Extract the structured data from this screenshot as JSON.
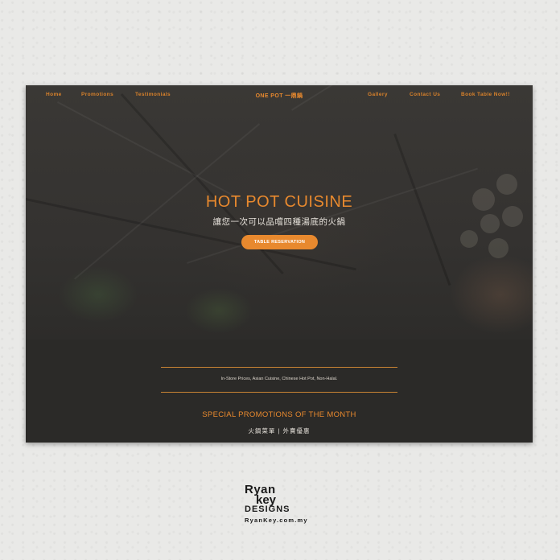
{
  "nav": {
    "left_items": [
      "Home",
      "Promotions",
      "Testimonials"
    ],
    "brand": "ONE POT 一鼎鍋",
    "right_items": [
      "Gallery",
      "Contact Us",
      "Book Table Now!!"
    ]
  },
  "hero": {
    "title": "HOT POT CUISINE",
    "subtitle": "讓您一次可以品嚐四種湯底的火鍋",
    "cta_label": "TABLE RESERVATION"
  },
  "info": {
    "tags": "In-Store Prices, Asian Cuisine, Chinese Hot Pot, Non-Halal."
  },
  "promotions": {
    "title": "SPECIAL PROMOTIONS OF THE MONTH",
    "subtitle": "火鍋菜單 | 外賣優惠"
  },
  "watermark": {
    "line1": "Ryan",
    "line2": "key",
    "line3": "DESIGNS",
    "url": "RyanKey.com.my"
  },
  "colors": {
    "accent": "#e8892e",
    "background": "#2b2a28",
    "paper": "#e9e9e7"
  }
}
